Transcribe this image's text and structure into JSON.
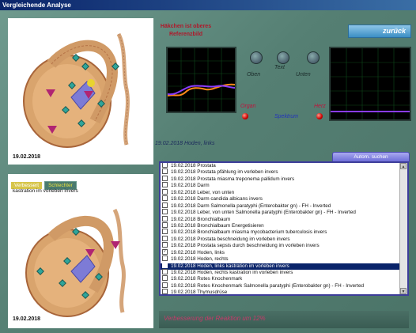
{
  "window": {
    "title": "Vergleichende Analyse"
  },
  "reference": {
    "line1": "Häkchen ist oberes",
    "line2": "Referenzbild"
  },
  "buttons": {
    "back": "zurück",
    "auto_search": "Autom. suchen"
  },
  "top_panel": {
    "date": "19.02.2018"
  },
  "bottom_panel": {
    "date": "19.02.2018",
    "note": "kastration im vorleben invers"
  },
  "tabs": {
    "better": "Verbessert",
    "worse": "Schlechter"
  },
  "controls": {
    "top": "Oben",
    "text": "Text",
    "bottom": "Unten",
    "organ": "Organ",
    "spectrum": "Spektrum",
    "heart": "Herz"
  },
  "selected_item": "19.02.2018 Hoden, links",
  "list": [
    {
      "text": "19.02.2018  Prostata",
      "checked": false,
      "selected": false
    },
    {
      "text": "19.02.2018  Prostata  pfählung im vorleben invers",
      "checked": false,
      "selected": false
    },
    {
      "text": "19.02.2018  Prostata  miasma treponema pallidum invers",
      "checked": false,
      "selected": false
    },
    {
      "text": "19.02.2018  Darm",
      "checked": false,
      "selected": false
    },
    {
      "text": "19.02.2018  Leber, von unten",
      "checked": false,
      "selected": false
    },
    {
      "text": "19.02.2018  Darm  candida albicans invers",
      "checked": false,
      "selected": false
    },
    {
      "text": "19.02.2018  Darm  Salmonella paratyphi (Enterobakter gn) - FH - Inverted",
      "checked": false,
      "selected": false
    },
    {
      "text": "19.02.2018  Leber, von unten  Salmonella paratyphi (Enterobakter gn) - FH - Inverted",
      "checked": false,
      "selected": false
    },
    {
      "text": "19.02.2018  Bronchialbaum",
      "checked": false,
      "selected": false
    },
    {
      "text": "19.02.2018  Bronchialbaum  Energetisieren",
      "checked": false,
      "selected": false
    },
    {
      "text": "19.02.2018  Bronchialbaum  miasma mycobacterium tuberculosis invers",
      "checked": false,
      "selected": false
    },
    {
      "text": "19.02.2018  Prostata  beschneidung im vorleben invers",
      "checked": false,
      "selected": false
    },
    {
      "text": "19.02.2018  Prostata  sepsis durch beschneidung im vorleben invers",
      "checked": false,
      "selected": false
    },
    {
      "text": "19.02.2018  Hoden, links",
      "checked": true,
      "selected": false
    },
    {
      "text": "19.02.2018  Hoden, rechts",
      "checked": false,
      "selected": false
    },
    {
      "text": "19.02.2018  Hoden, links  kastration im vorleben invers",
      "checked": false,
      "selected": true
    },
    {
      "text": "19.02.2018  Hoden, rechts  kastration im vorleben invers",
      "checked": false,
      "selected": false
    },
    {
      "text": "19.02.2018  Rotes Knochenmark",
      "checked": false,
      "selected": false
    },
    {
      "text": "19.02.2018  Rotes Knochenmark  Salmonella paratyphi (Enterobakter gn) - FH - Inverted",
      "checked": false,
      "selected": false
    },
    {
      "text": "19.02.2018  Thymusdrüse",
      "checked": false,
      "selected": false
    }
  ],
  "result": "Verbesserung der Reaktion um 12%",
  "colors": {
    "accent": "#c83a6a",
    "list_border": "#3d3d9a",
    "selection": "#0a246a"
  }
}
